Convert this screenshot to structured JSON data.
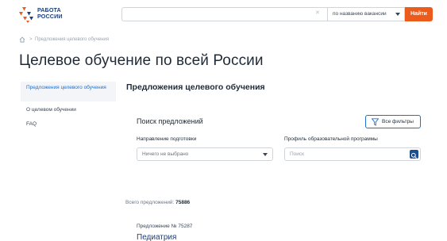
{
  "header": {
    "logo_line1": "РАБОТА",
    "logo_line2": "РОССИИ",
    "search": {
      "value": "",
      "placeholder": ""
    },
    "search_mode": "по названию вакансии",
    "search_button": "Найти",
    "accent_color": "#ea5b1c"
  },
  "breadcrumb": {
    "home_icon": "home-icon",
    "separator": ">",
    "current": "Предложения целевого обучения"
  },
  "page_title": "Целевое обучение по всей России",
  "side_nav": {
    "items": [
      {
        "label": "Предложения целевого обучения",
        "active": true
      },
      {
        "label": "О целевом обучении",
        "active": false
      },
      {
        "label": "FAQ",
        "active": false
      }
    ]
  },
  "section_title": "Предложения целевого обучения",
  "search_panel": {
    "heading": "Поиск предложений",
    "filters_button": "Все фильтры",
    "direction_label": "Направление подготовки",
    "direction_value": "Ничего не выбрано",
    "profile_label": "Профиль образовательной программы",
    "profile_placeholder": "Поиск"
  },
  "results": {
    "total_label": "Всего предложений:",
    "total_count": "75886"
  },
  "offer": {
    "number": "Предложение № 75287",
    "title": "Педиатрия"
  }
}
